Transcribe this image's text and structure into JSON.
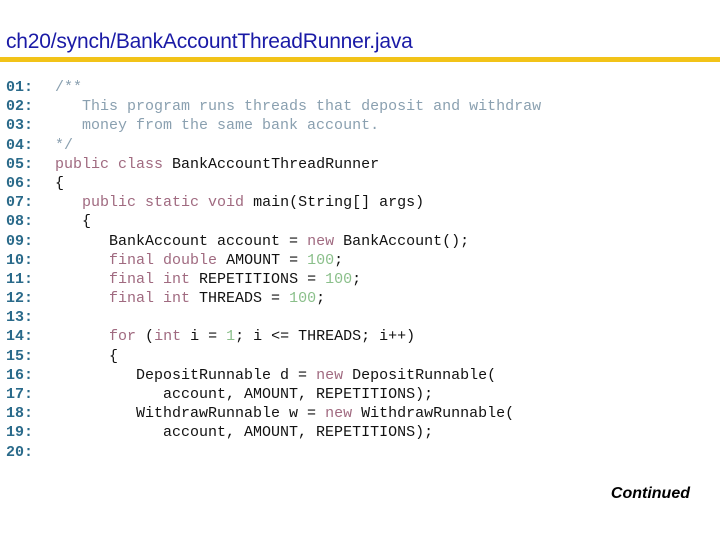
{
  "title": "ch20/synch/BankAccountThreadRunner.java",
  "continued_label": "Continued",
  "colors": {
    "title": "#1a1aa6",
    "rule": "#f2c318",
    "line_number": "#2a6a8a",
    "keyword": "#a06a80",
    "comment": "#8aa0b0",
    "number": "#8abf8a",
    "text": "#111111"
  },
  "code_lines": [
    {
      "n": "01:",
      "tokens": [
        {
          "t": "cm",
          "s": "/**"
        }
      ]
    },
    {
      "n": "02:",
      "tokens": [
        {
          "t": "cm",
          "s": "   This program runs threads that deposit and withdraw"
        }
      ]
    },
    {
      "n": "03:",
      "tokens": [
        {
          "t": "cm",
          "s": "   money from the same bank account."
        }
      ]
    },
    {
      "n": "04:",
      "tokens": [
        {
          "t": "cm",
          "s": "*/"
        }
      ]
    },
    {
      "n": "05:",
      "tokens": [
        {
          "t": "kw",
          "s": "public class"
        },
        {
          "t": "tx",
          "s": " BankAccountThreadRunner"
        }
      ]
    },
    {
      "n": "06:",
      "tokens": [
        {
          "t": "tx",
          "s": "{"
        }
      ]
    },
    {
      "n": "07:",
      "tokens": [
        {
          "t": "tx",
          "s": "   "
        },
        {
          "t": "kw",
          "s": "public static void"
        },
        {
          "t": "tx",
          "s": " main(String[] args)"
        }
      ]
    },
    {
      "n": "08:",
      "tokens": [
        {
          "t": "tx",
          "s": "   {"
        }
      ]
    },
    {
      "n": "09:",
      "tokens": [
        {
          "t": "tx",
          "s": "      BankAccount account = "
        },
        {
          "t": "kw",
          "s": "new"
        },
        {
          "t": "tx",
          "s": " BankAccount();"
        }
      ]
    },
    {
      "n": "10:",
      "tokens": [
        {
          "t": "tx",
          "s": "      "
        },
        {
          "t": "kw",
          "s": "final double"
        },
        {
          "t": "tx",
          "s": " AMOUNT = "
        },
        {
          "t": "num",
          "s": "100"
        },
        {
          "t": "tx",
          "s": ";"
        }
      ]
    },
    {
      "n": "11:",
      "tokens": [
        {
          "t": "tx",
          "s": "      "
        },
        {
          "t": "kw",
          "s": "final int"
        },
        {
          "t": "tx",
          "s": " REPETITIONS = "
        },
        {
          "t": "num",
          "s": "100"
        },
        {
          "t": "tx",
          "s": ";"
        }
      ]
    },
    {
      "n": "12:",
      "tokens": [
        {
          "t": "tx",
          "s": "      "
        },
        {
          "t": "kw",
          "s": "final int"
        },
        {
          "t": "tx",
          "s": " THREADS = "
        },
        {
          "t": "num",
          "s": "100"
        },
        {
          "t": "tx",
          "s": ";"
        }
      ]
    },
    {
      "n": "13:",
      "tokens": []
    },
    {
      "n": "14:",
      "tokens": [
        {
          "t": "tx",
          "s": "      "
        },
        {
          "t": "kw",
          "s": "for"
        },
        {
          "t": "tx",
          "s": " ("
        },
        {
          "t": "kw",
          "s": "int"
        },
        {
          "t": "tx",
          "s": " i = "
        },
        {
          "t": "num",
          "s": "1"
        },
        {
          "t": "tx",
          "s": "; i <= THREADS; i++)"
        }
      ]
    },
    {
      "n": "15:",
      "tokens": [
        {
          "t": "tx",
          "s": "      {"
        }
      ]
    },
    {
      "n": "16:",
      "tokens": [
        {
          "t": "tx",
          "s": "         DepositRunnable d = "
        },
        {
          "t": "kw",
          "s": "new"
        },
        {
          "t": "tx",
          "s": " DepositRunnable("
        }
      ]
    },
    {
      "n": "17:",
      "tokens": [
        {
          "t": "tx",
          "s": "            account, AMOUNT, REPETITIONS);"
        }
      ]
    },
    {
      "n": "18:",
      "tokens": [
        {
          "t": "tx",
          "s": "         WithdrawRunnable w = "
        },
        {
          "t": "kw",
          "s": "new"
        },
        {
          "t": "tx",
          "s": " WithdrawRunnable("
        }
      ]
    },
    {
      "n": "19:",
      "tokens": [
        {
          "t": "tx",
          "s": "            account, AMOUNT, REPETITIONS);"
        }
      ]
    },
    {
      "n": "20:",
      "tokens": []
    }
  ]
}
